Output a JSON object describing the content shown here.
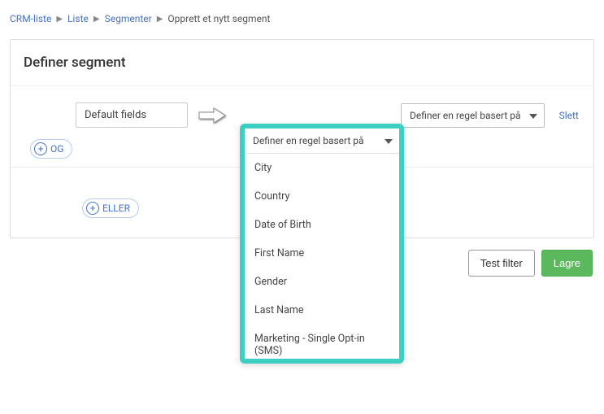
{
  "breadcrumb": {
    "items": [
      "CRM-liste",
      "Liste",
      "Segmenter"
    ],
    "current": "Opprett et nytt segment"
  },
  "panel": {
    "title": "Definer segment"
  },
  "rule": {
    "field_source": "Default fields",
    "define_label": "Definer en regel basert på",
    "define_label_2": "Definer en regel basert på",
    "delete_label": "Slett",
    "and_label": "OG",
    "or_label": "ELLER"
  },
  "dropdown": {
    "options": [
      "City",
      "Country",
      "Date of Birth",
      "First Name",
      "Gender",
      "Last Name",
      "Marketing - Single Opt-in (SMS)"
    ]
  },
  "footer": {
    "test_label": "Test filter",
    "save_label": "Lagre"
  }
}
